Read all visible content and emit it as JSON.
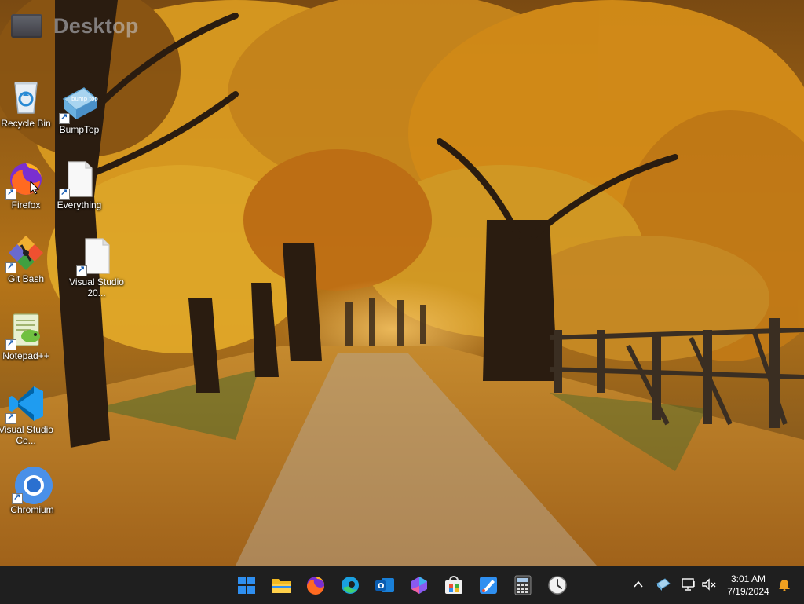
{
  "desktop": {
    "header_title": "Desktop",
    "icons": [
      {
        "label": "Recycle Bin",
        "icon": "recycle-bin-icon"
      },
      {
        "label": "BumpTop",
        "icon": "bumptop-icon"
      },
      {
        "label": "Firefox",
        "icon": "firefox-icon"
      },
      {
        "label": "Everything",
        "icon": "file-icon"
      },
      {
        "label": "Git Bash",
        "icon": "git-bash-icon"
      },
      {
        "label": "Visual Studio 20...",
        "icon": "file-icon"
      },
      {
        "label": "Notepad++",
        "icon": "notepadpp-icon"
      },
      {
        "label": "Visual Studio Co...",
        "icon": "vscode-icon"
      },
      {
        "label": "Chromium",
        "icon": "chromium-icon"
      }
    ],
    "bumptop_text": "bump top"
  },
  "taskbar": {
    "apps": [
      {
        "name": "Start",
        "icon": "windows-start-icon"
      },
      {
        "name": "File Explorer",
        "icon": "folder-icon"
      },
      {
        "name": "Firefox",
        "icon": "firefox-icon"
      },
      {
        "name": "Edge",
        "icon": "edge-icon"
      },
      {
        "name": "Outlook",
        "icon": "outlook-icon"
      },
      {
        "name": "Copilot",
        "icon": "copilot-icon"
      },
      {
        "name": "Microsoft Store",
        "icon": "store-icon"
      },
      {
        "name": "Paint",
        "icon": "paint-icon"
      },
      {
        "name": "Calculator",
        "icon": "calculator-icon"
      },
      {
        "name": "Clock",
        "icon": "clock-icon"
      }
    ],
    "outlook_letter": "O",
    "clock": {
      "time": "3:01 AM",
      "date": "7/19/2024"
    }
  },
  "colors": {
    "taskbar_bg": "#1f1f1f",
    "windows_blue": "#2f8ff0",
    "notification": "#f0a020"
  }
}
